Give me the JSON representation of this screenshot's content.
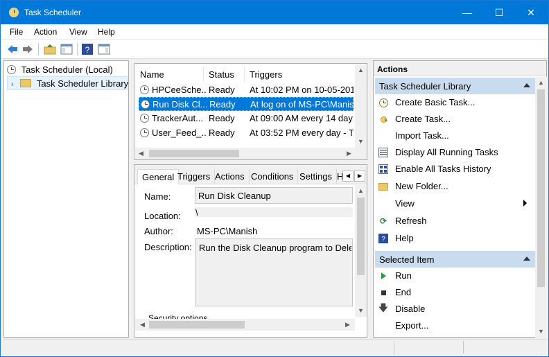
{
  "window": {
    "title": "Task Scheduler",
    "accent": "#0078d7"
  },
  "menu": [
    "File",
    "Action",
    "View",
    "Help"
  ],
  "tree": {
    "root": "Task Scheduler (Local)",
    "library": "Task Scheduler Library"
  },
  "tasks": {
    "columns": [
      "Name",
      "Status",
      "Triggers"
    ],
    "rows": [
      {
        "name": "HPCeeSche...",
        "status": "Ready",
        "trigger": "At 10:02 PM on 10-05-201"
      },
      {
        "name": "Run Disk Cl...",
        "status": "Ready",
        "trigger": "At log on of MS-PC\\Manis"
      },
      {
        "name": "TrackerAut...",
        "status": "Ready",
        "trigger": "At 09:00 AM every 14 day"
      },
      {
        "name": "User_Feed_...",
        "status": "Ready",
        "trigger": "At 03:52 PM every day - T"
      }
    ],
    "selected_row": 1
  },
  "tabs": [
    "General",
    "Triggers",
    "Actions",
    "Conditions",
    "Settings",
    "H"
  ],
  "details": {
    "name_label": "Name:",
    "name_value": "Run Disk Cleanup",
    "location_label": "Location:",
    "location_value": "\\",
    "author_label": "Author:",
    "author_value": "MS-PC\\Manish",
    "description_label": "Description:",
    "description_value": "Run the Disk Cleanup program to Delete t",
    "security_label": "Security options"
  },
  "actions": {
    "header": "Actions",
    "library_section": "Task Scheduler Library",
    "library_items": [
      {
        "label": "Create Basic Task...",
        "icon": "create-basic-task-icon"
      },
      {
        "label": "Create Task...",
        "icon": "create-task-icon"
      },
      {
        "label": "Import Task...",
        "icon": ""
      },
      {
        "label": "Display All Running Tasks",
        "icon": "running-tasks-icon"
      },
      {
        "label": "Enable All Tasks History",
        "icon": "tasks-history-icon"
      },
      {
        "label": "New Folder...",
        "icon": "new-folder-icon"
      },
      {
        "label": "View",
        "icon": ""
      },
      {
        "label": "Refresh",
        "icon": "refresh-icon"
      },
      {
        "label": "Help",
        "icon": "help-icon"
      }
    ],
    "selected_section": "Selected Item",
    "selected_items": [
      {
        "label": "Run",
        "icon": "run-icon"
      },
      {
        "label": "End",
        "icon": "end-icon"
      },
      {
        "label": "Disable",
        "icon": "disable-icon"
      },
      {
        "label": "Export...",
        "icon": ""
      }
    ]
  }
}
